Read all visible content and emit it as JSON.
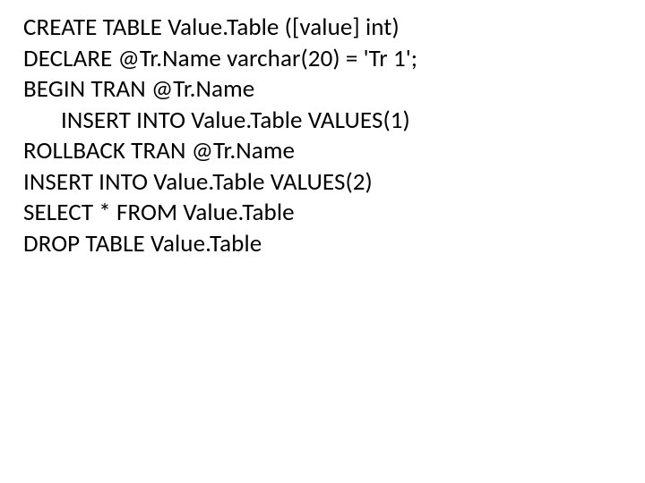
{
  "code": {
    "lines": [
      "CREATE TABLE Value.Table ([value] int)",
      "DECLARE @Tr.Name varchar(20) = 'Tr 1';",
      "BEGIN TRAN @Tr.Name",
      "INSERT INTO Value.Table VALUES(1)",
      "ROLLBACK TRAN @Tr.Name",
      "INSERT INTO Value.Table VALUES(2)",
      "SELECT * FROM Value.Table",
      "DROP TABLE Value.Table"
    ]
  }
}
